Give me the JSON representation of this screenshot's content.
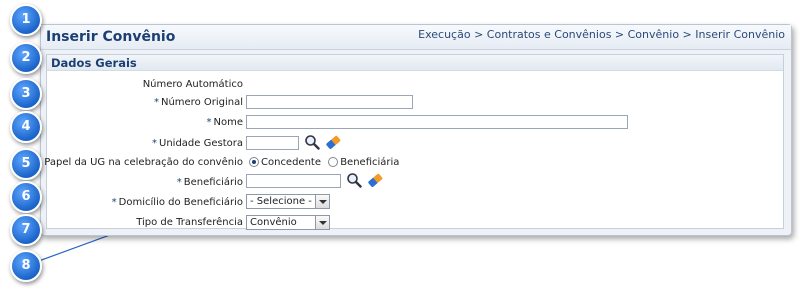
{
  "header": {
    "title": "Inserir Convênio",
    "breadcrumb": "Execução > Contratos e Convênios > Convênio > Inserir Convênio"
  },
  "section": {
    "title": "Dados Gerais"
  },
  "form": {
    "required_mark": "*",
    "numero_automatico_label": "Número Automático",
    "numero_original_label": "Número Original",
    "numero_original_value": "",
    "nome_label": "Nome",
    "nome_value": "",
    "unidade_gestora_label": "Unidade Gestora",
    "unidade_gestora_value": "",
    "papel_label": "Papel da UG na celebração do convênio",
    "papel_options": [
      "Concedente",
      "Beneficiária"
    ],
    "papel_selected": "Concedente",
    "beneficiario_label": "Beneficiário",
    "beneficiario_value": "",
    "domicilio_label": "Domicílio do Beneficiário",
    "domicilio_value": "- Selecione -",
    "tipo_label": "Tipo de Transferência",
    "tipo_value": "Convênio"
  },
  "callouts": [
    "1",
    "2",
    "3",
    "4",
    "5",
    "6",
    "7",
    "8"
  ],
  "icons": {
    "search": "magnifier-icon",
    "clear": "eraser-icon"
  },
  "colors": {
    "accent": "#1c3f73",
    "marker": "#1a64c9"
  }
}
